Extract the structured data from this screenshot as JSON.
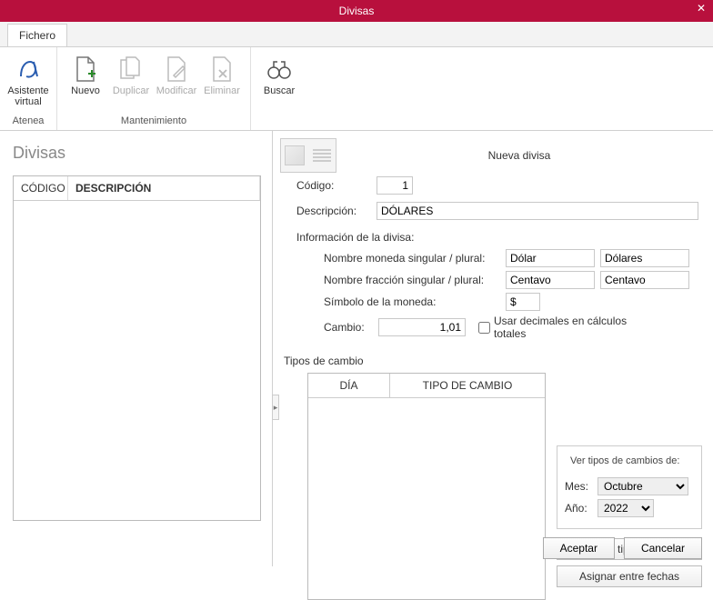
{
  "title": "Divisas",
  "tab": "Fichero",
  "ribbon": {
    "group_atenea": "Atenea",
    "group_mant": "Mantenimiento",
    "asistente": "Asistente virtual",
    "nuevo": "Nuevo",
    "duplicar": "Duplicar",
    "modificar": "Modificar",
    "eliminar": "Eliminar",
    "buscar": "Buscar"
  },
  "left": {
    "heading": "Divisas",
    "col1": "CÓDIGO",
    "col2": "DESCRIPCIÓN"
  },
  "panel": {
    "title": "Nueva divisa",
    "codigo_label": "Código:",
    "codigo": "1",
    "descripcion_label": "Descripción:",
    "descripcion": "DÓLARES",
    "info_label": "Información de la divisa:",
    "nombre_moneda_label": "Nombre moneda singular / plural:",
    "nombre_moneda_sing": "Dólar",
    "nombre_moneda_plur": "Dólares",
    "nombre_fraccion_label": "Nombre fracción singular / plural:",
    "nombre_fraccion_sing": "Centavo",
    "nombre_fraccion_plur": "Centavo",
    "simbolo_label": "Símbolo de la moneda:",
    "simbolo": "$",
    "cambio_label": "Cambio:",
    "cambio": "1,01",
    "chk_label": "Usar decimales en cálculos totales",
    "tipos_label": "Tipos de cambio",
    "th_dia": "DÍA",
    "th_tipo": "TIPO DE CAMBIO",
    "ver_label": "Ver tipos de cambios de:",
    "mes_label": "Mes:",
    "mes": "Octubre",
    "ano_label": "Año:",
    "ano": "2022",
    "btn_modificar": "Modificar tipo de cambio",
    "btn_asignar": "Asignar entre fechas"
  },
  "footer": {
    "aceptar": "Aceptar",
    "cancelar": "Cancelar"
  }
}
